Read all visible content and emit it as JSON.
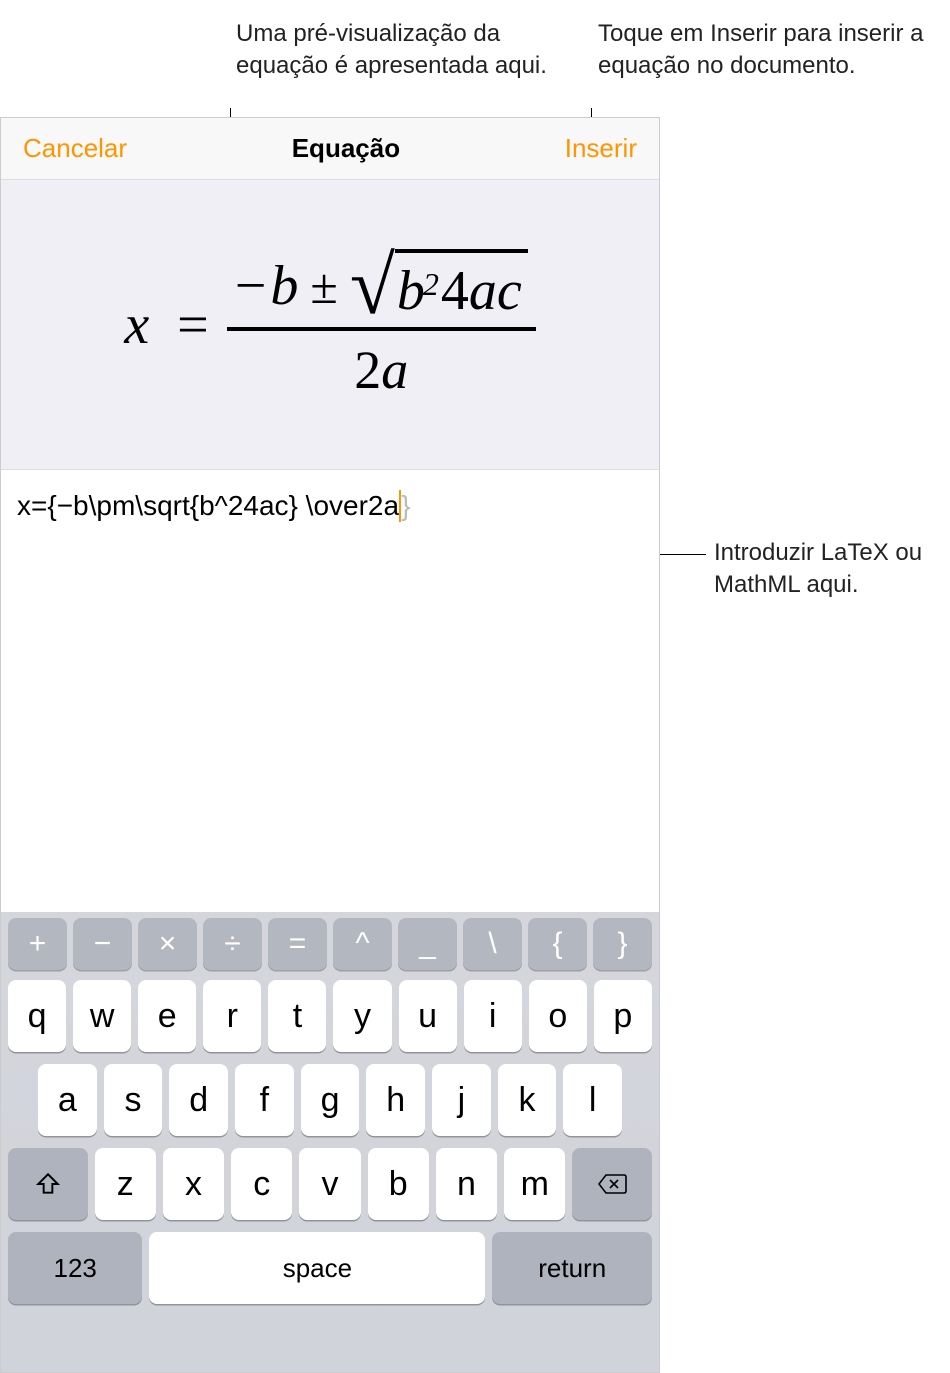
{
  "callouts": {
    "preview": "Uma pré-visualização da equação é apresentada aqui.",
    "insert": "Toque em Inserir para inserir a equação no documento.",
    "input": "Introduzir LaTeX ou MathML aqui."
  },
  "modal": {
    "cancel_label": "Cancelar",
    "title": "Equação",
    "insert_label": "Inserir"
  },
  "latex_source": "x={−b\\pm\\sqrt{b^24ac} \\over2a",
  "closing": "}",
  "keyboard": {
    "sym_row": [
      "+",
      "−",
      "×",
      "÷",
      "=",
      "^",
      "_",
      "\\",
      "{",
      "}"
    ],
    "row1": [
      "q",
      "w",
      "e",
      "r",
      "t",
      "y",
      "u",
      "i",
      "o",
      "p"
    ],
    "row2": [
      "a",
      "s",
      "d",
      "f",
      "g",
      "h",
      "j",
      "k",
      "l"
    ],
    "row3": [
      "z",
      "x",
      "c",
      "v",
      "b",
      "n",
      "m"
    ],
    "num_label": "123",
    "space_label": "space",
    "return_label": "return"
  }
}
